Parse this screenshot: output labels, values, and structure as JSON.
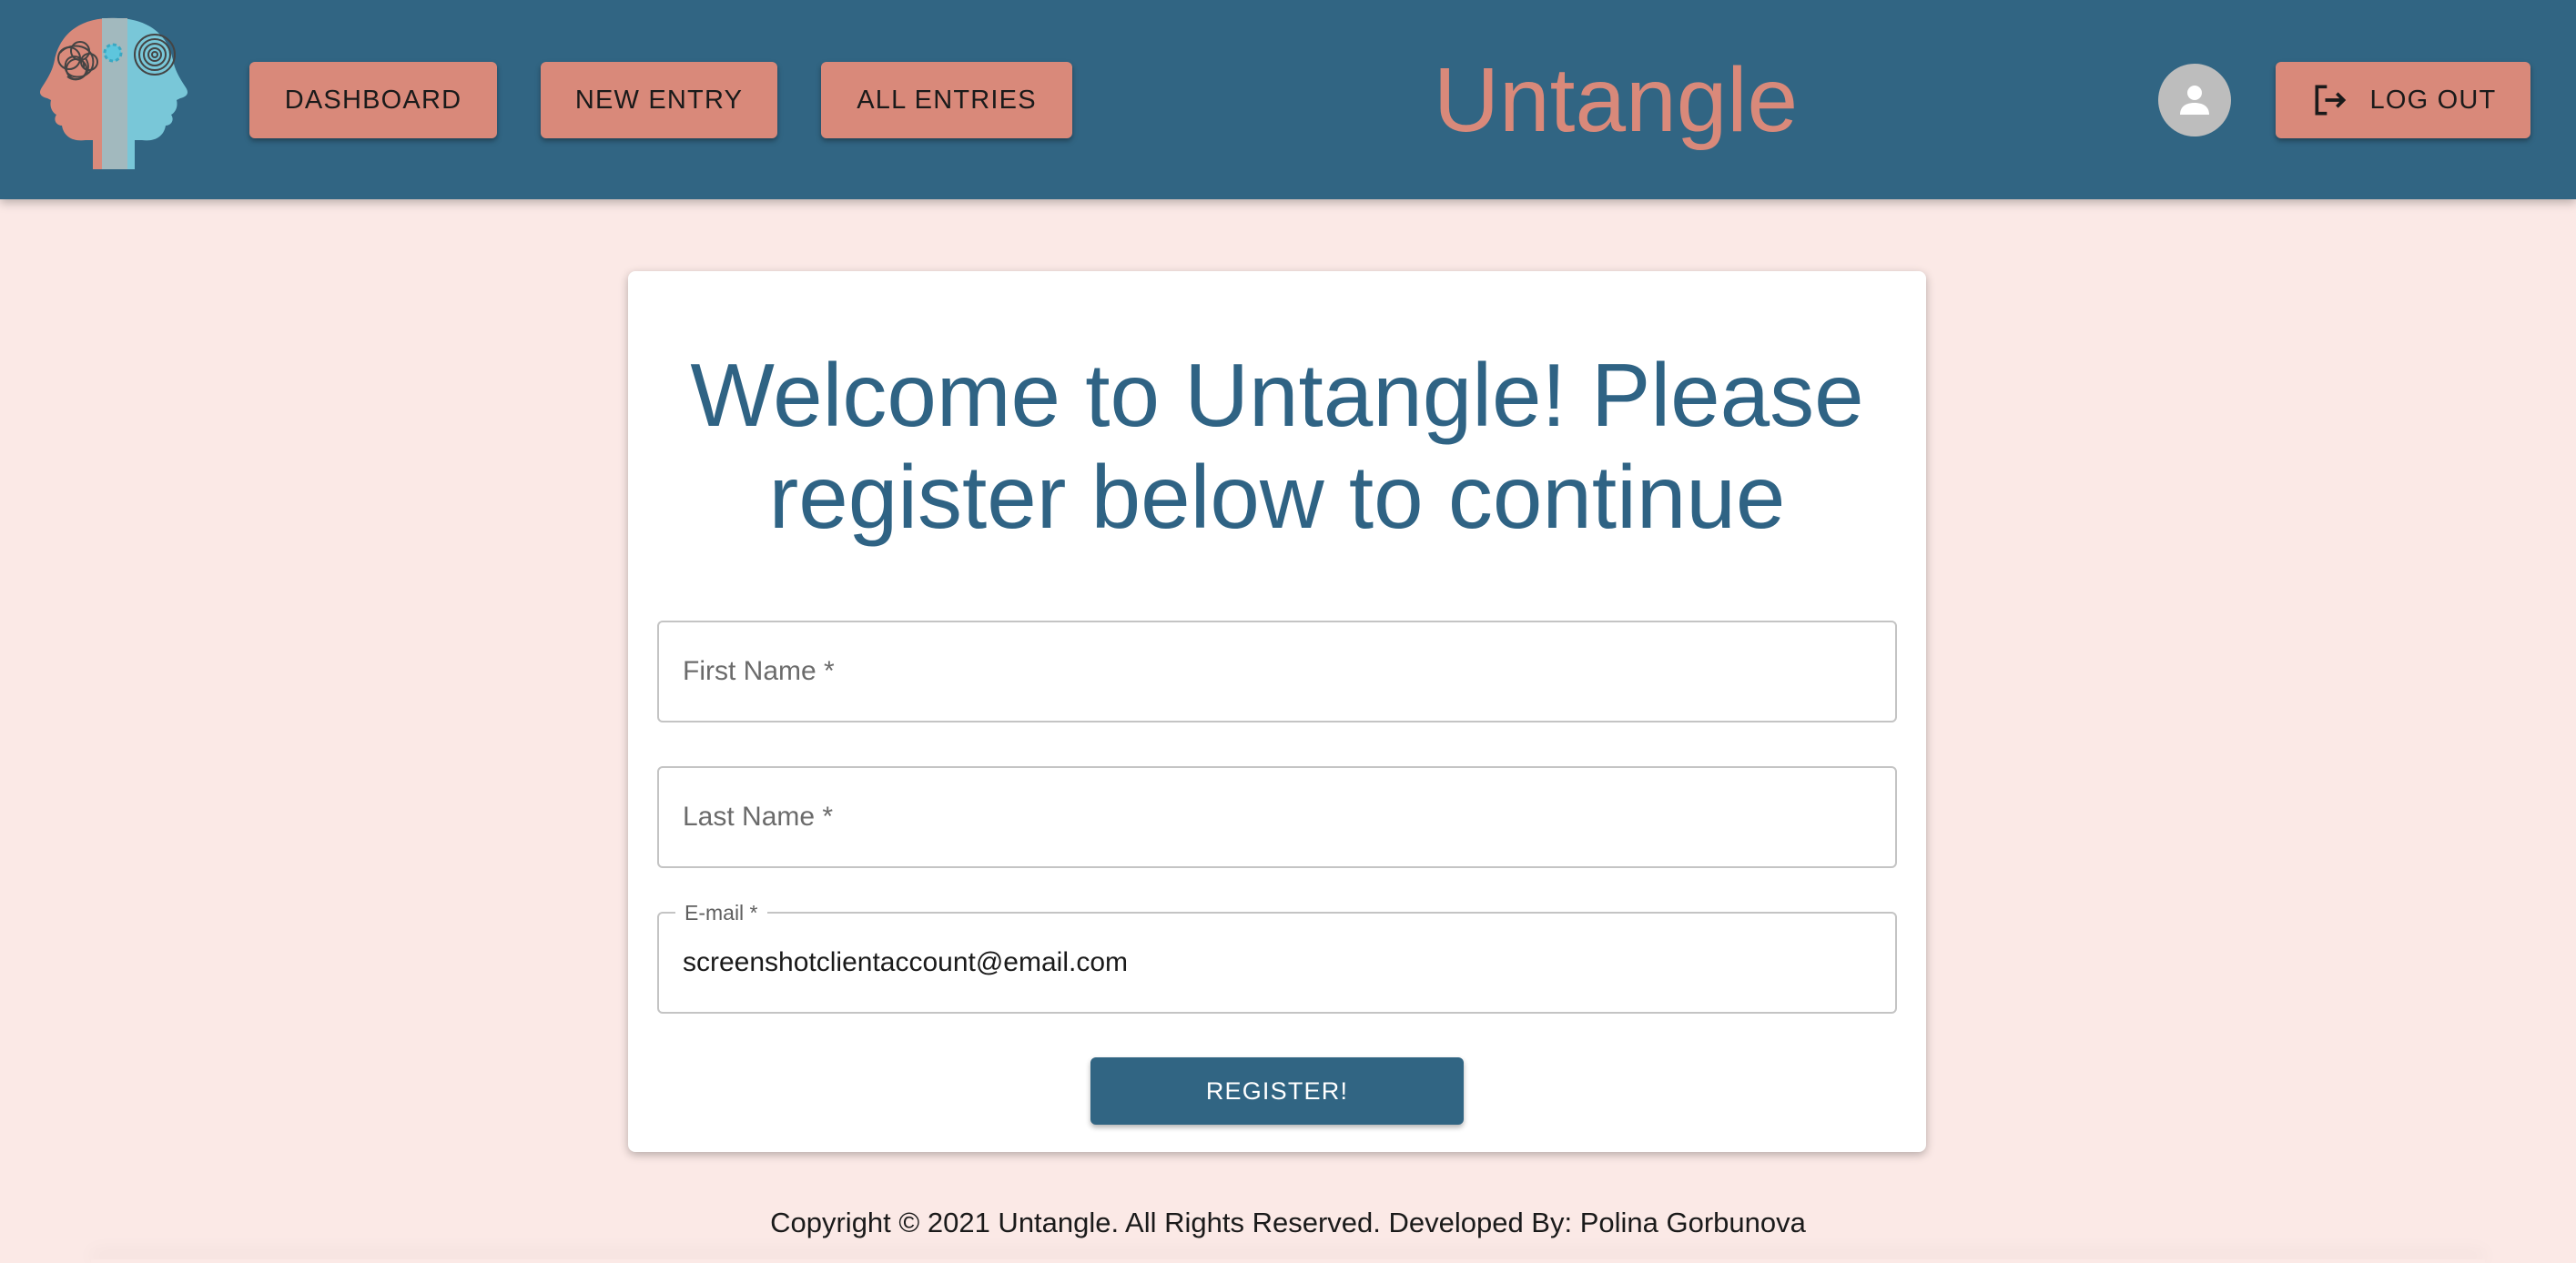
{
  "header": {
    "nav": {
      "dashboard": "DASHBOARD",
      "new_entry": "NEW ENTRY",
      "all_entries": "ALL ENTRIES"
    },
    "brand": "Untangle",
    "avatar_icon": "person-icon",
    "logout_label": "LOG OUT",
    "logout_icon": "logout-icon"
  },
  "register": {
    "title": "Welcome to Untangle! Please register below to continue",
    "first_name": {
      "placeholder": "First Name *",
      "value": ""
    },
    "last_name": {
      "placeholder": "Last Name *",
      "value": ""
    },
    "email": {
      "label": "E-mail *",
      "value": "screenshotclientaccount@email.com"
    },
    "submit_label": "REGISTER!"
  },
  "footer": {
    "text": "Copyright © 2021 Untangle. All Rights Reserved. Developed By: Polina Gorbunova"
  },
  "colors": {
    "appbar": "#316583",
    "accent": "#d9897a",
    "background": "#fbe9e6",
    "title": "#2f6384"
  }
}
